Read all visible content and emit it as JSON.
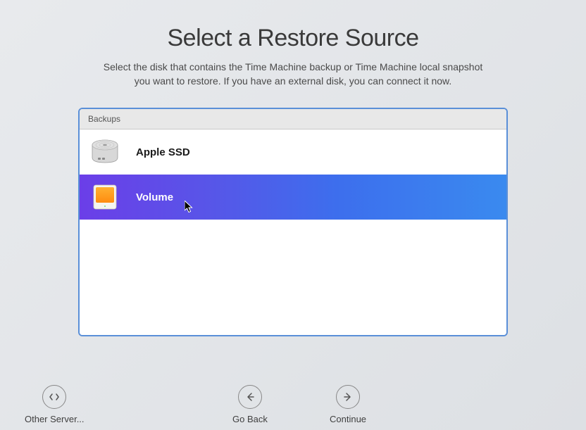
{
  "title": "Select a Restore Source",
  "subtitle_line1": "Select the disk that contains the Time Machine backup or Time Machine local snapshot",
  "subtitle_line2": "you want to restore. If you have an external disk, you can connect it now.",
  "list_header": "Backups",
  "items": [
    {
      "label": "Apple SSD",
      "icon": "internal-drive",
      "selected": false
    },
    {
      "label": "Volume",
      "icon": "external-drive",
      "selected": true
    }
  ],
  "buttons": {
    "other_server": "Other Server...",
    "go_back": "Go Back",
    "continue": "Continue"
  }
}
